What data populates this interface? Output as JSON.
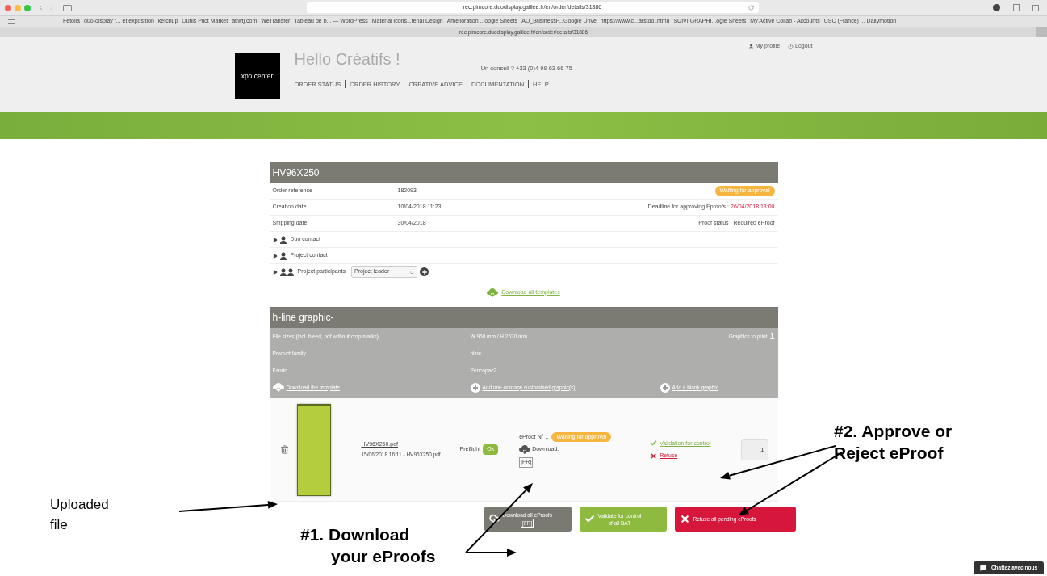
{
  "browser": {
    "url": "rec.pimcore.duodisplay.galilee.fr/en/order/details/31886",
    "bookmarks": [
      "Fetolia",
      "duo-display f... et exposition",
      "ketchup",
      "Outils Pilot Market",
      "atiwtj.com",
      "WeTransfer",
      "Tableau de b... — WordPress",
      "Material icons...terial Design",
      "Amélioration ...oogle Sheets",
      "AO_BusinessF...Google Drive",
      "https://www.c...arstool.html)",
      "SUIVI GRAPHI...ogle Sheets",
      "My Active Collab - Accounts",
      "CSC (France) ... Dailymotion"
    ],
    "status_url": "rec.pimcore.duodisplay.galilee.fr/en/order/details/31886"
  },
  "header": {
    "logo": "xpo.center",
    "greeting": "Hello Créatifs !",
    "advice": "Un conseil ? +33 (0)4 99 63 66 75",
    "user_links": [
      {
        "kind": "profile",
        "label": "My profile"
      },
      {
        "kind": "logout",
        "label": "Logout"
      }
    ],
    "nav": [
      "ORDER STATUS",
      "ORDER HISTORY",
      "CREATIVE ADVICE",
      "DOCUMENTATION",
      "HELP"
    ]
  },
  "order": {
    "title": "HV96X250",
    "info_rows": [
      {
        "label": "Order reference",
        "value": "182093"
      },
      {
        "label": "Creation date",
        "value": "10/04/2018 11:23"
      },
      {
        "label": "Shipping date",
        "value": "30/04/2018"
      }
    ],
    "status_badge": "Waiting for approval",
    "deadline_label": "Deadline for approving Eproofs :",
    "deadline": "26/04/2018 13:00",
    "proof_status_label": "Proof status :",
    "proof_status": "Required eProof",
    "contacts": [
      {
        "kind": "person",
        "label": "Duo contact",
        "expanded": false
      },
      {
        "kind": "person",
        "label": "Project contact",
        "expanded": false
      },
      {
        "kind": "group",
        "label": "Project participants",
        "expanded": false,
        "select": "Project leader"
      }
    ],
    "download_all_templates": "Download all templates"
  },
  "graphic": {
    "title": "h-line graphic-",
    "specs": [
      {
        "label": "File sizes (incl. bleed, pdf without crop marks)",
        "value": "W 960 mm / H 2530 mm"
      },
      {
        "label": "Product family",
        "value": "hline"
      },
      {
        "label": "Fabric",
        "value": "Pencopac2"
      }
    ],
    "graphics_to_print_label": "Graphics to print",
    "graphics_to_print": "1",
    "actions": [
      {
        "kind": "cloud",
        "label": "Download the template"
      },
      {
        "kind": "plus",
        "label": "Add one or many customised graphic(s)"
      },
      {
        "kind": "plus",
        "label": "Add a blank graphic"
      }
    ],
    "file": {
      "name": "HV96X250.pdf",
      "meta": "15/06/2018 16:11 - HV96X250.pdf",
      "preflight_label": "Preflight",
      "preflight_status": "Ok",
      "eproof_title": "eProof N° 1",
      "eproof_status": "Waiting for approval",
      "download_label": "Download:",
      "lang": "[FR]",
      "validate_link": "Validation for control",
      "refuse_link": "Refuse",
      "quantity": "1"
    },
    "buttons": [
      {
        "kind": "download",
        "lines": [
          "Download all eProofs",
          "[FR]"
        ]
      },
      {
        "kind": "validate",
        "lines": [
          "Validate for control",
          "of all BAT"
        ]
      },
      {
        "kind": "refuse",
        "lines": [
          "Refuse all pending eProofs"
        ]
      }
    ]
  },
  "annotations": [
    {
      "kind": "uploaded",
      "lines": [
        "Uploaded",
        "file"
      ]
    },
    {
      "kind": "download",
      "lines": [
        "#1. Download",
        "your eProofs"
      ]
    },
    {
      "kind": "approve",
      "lines": [
        "#2. Approve or",
        "Reject eProof"
      ]
    }
  ],
  "chat_button": "Chattez avec nous"
}
